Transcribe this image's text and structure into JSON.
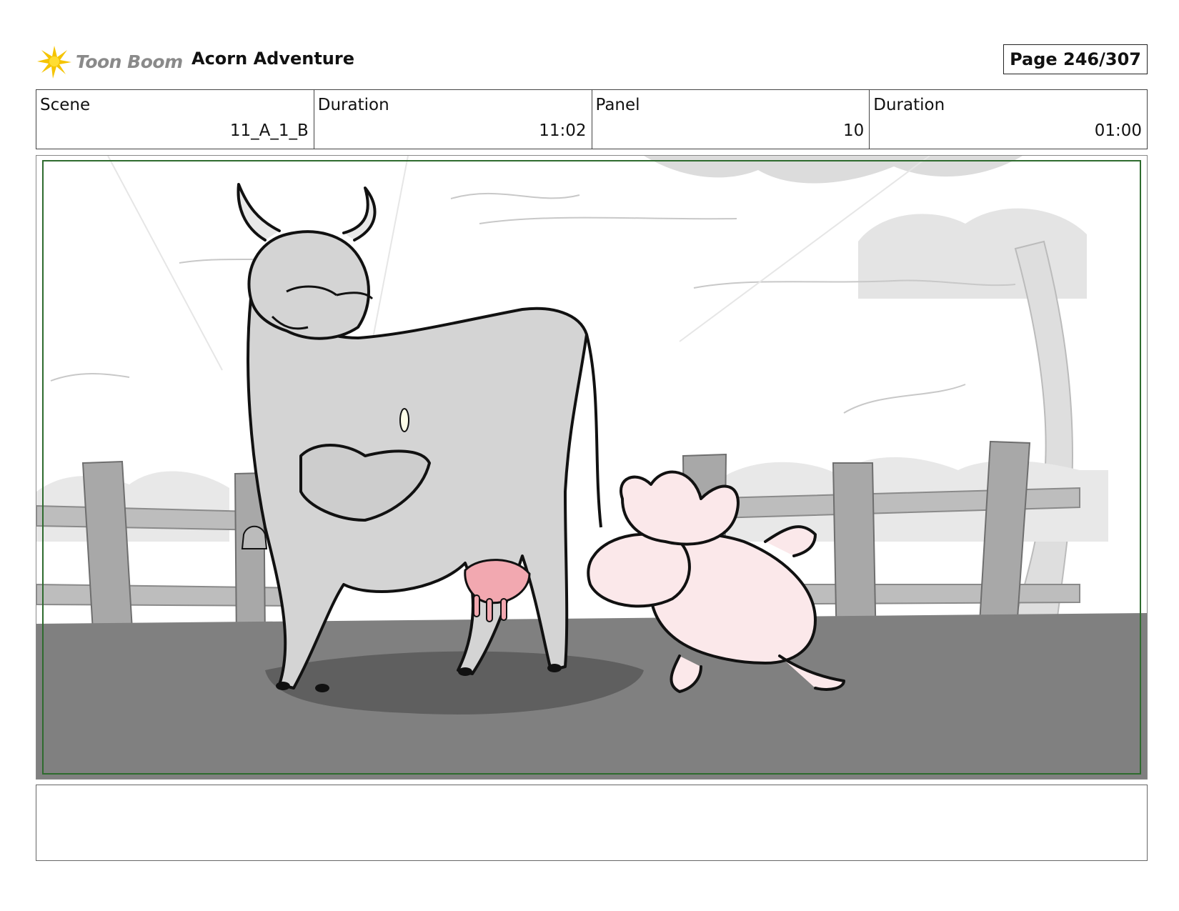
{
  "header": {
    "logo_text": "Toon Boom",
    "project_title": "Acorn Adventure",
    "page_label": "Page 246/307"
  },
  "info": {
    "scene_label": "Scene",
    "scene_value": "11_A_1_B",
    "scene_duration_label": "Duration",
    "scene_duration_value": "11:02",
    "panel_label": "Panel",
    "panel_value": "10",
    "panel_duration_label": "Duration",
    "panel_duration_value": "01:00"
  },
  "panel": {
    "frame_color": "#2e6b2e",
    "content": "storyboard-sketch"
  },
  "notes": {
    "text": ""
  }
}
